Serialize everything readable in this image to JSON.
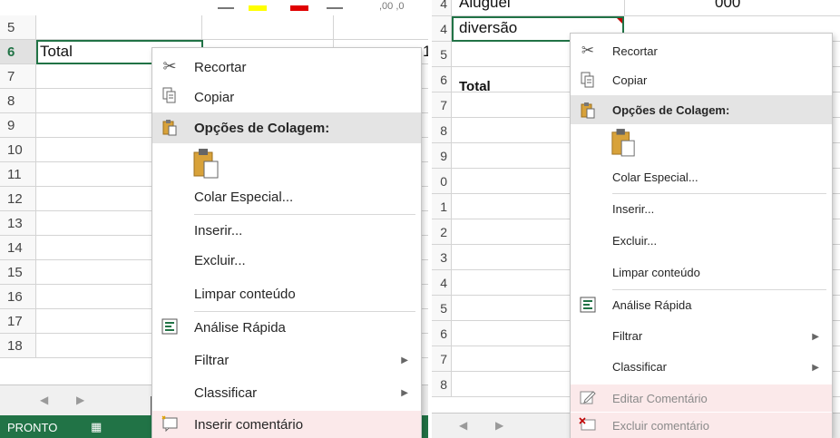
{
  "left": {
    "rows": [
      {
        "num": "5",
        "text": ""
      },
      {
        "num": "6",
        "text": "Total"
      },
      {
        "num": "7",
        "text": ""
      },
      {
        "num": "8",
        "text": ""
      },
      {
        "num": "9",
        "text": ""
      },
      {
        "num": "10",
        "text": ""
      },
      {
        "num": "11",
        "text": ""
      },
      {
        "num": "12",
        "text": ""
      },
      {
        "num": "13",
        "text": ""
      },
      {
        "num": "14",
        "text": ""
      },
      {
        "num": "15",
        "text": ""
      },
      {
        "num": "16",
        "text": ""
      },
      {
        "num": "17",
        "text": ""
      },
      {
        "num": "18",
        "text": ""
      }
    ],
    "active_row": "6",
    "edge_digit": "1",
    "tab_prev": "◀",
    "tab_next": "▶",
    "status": "PRONTO",
    "ribbon_fragment": ",00 ,0",
    "menu": {
      "cut": "Recortar",
      "copy": "Copiar",
      "paste_header": "Opções de Colagem:",
      "paste_special": "Colar Especial...",
      "insert": "Inserir...",
      "delete": "Excluir...",
      "clear": "Limpar conteúdo",
      "quick_analysis": "Análise Rápida",
      "filter": "Filtrar",
      "sort": "Classificar",
      "insert_comment": "Inserir comentário"
    }
  },
  "right": {
    "rows": [
      {
        "num": "4",
        "text": "Aluguel",
        "value": "000"
      },
      {
        "num": "4",
        "text": "diversão",
        "value": ""
      },
      {
        "num": "5",
        "text": "",
        "value": ""
      },
      {
        "num": "6",
        "text": "Total",
        "value": ""
      },
      {
        "num": "7",
        "text": "",
        "value": ""
      },
      {
        "num": "8",
        "text": "",
        "value": ""
      },
      {
        "num": "9",
        "text": "",
        "value": ""
      },
      {
        "num": "0",
        "text": "",
        "value": ""
      },
      {
        "num": "1",
        "text": "",
        "value": ""
      },
      {
        "num": "2",
        "text": "",
        "value": ""
      },
      {
        "num": "3",
        "text": "",
        "value": ""
      },
      {
        "num": "4",
        "text": "",
        "value": ""
      },
      {
        "num": "5",
        "text": "",
        "value": ""
      },
      {
        "num": "6",
        "text": "",
        "value": ""
      },
      {
        "num": "7",
        "text": "",
        "value": ""
      },
      {
        "num": "8",
        "text": "",
        "value": ""
      }
    ],
    "tab_prev": "◀",
    "tab_next": "▶",
    "menu": {
      "cut": "Recortar",
      "copy": "Copiar",
      "paste_header": "Opções de Colagem:",
      "paste_special": "Colar Especial...",
      "insert": "Inserir...",
      "delete": "Excluir...",
      "clear": "Limpar conteúdo",
      "quick_analysis": "Análise Rápida",
      "filter": "Filtrar",
      "sort": "Classificar",
      "edit_comment": "Editar Comentário",
      "delete_comment": "Excluir comentário"
    }
  },
  "colors": {
    "excel_green": "#217346",
    "highlight_yellow": "#ffff00",
    "font_red": "#e00000",
    "menu_pink": "#fbe9ea",
    "header_gray": "#e4e4e4"
  },
  "icons": {
    "cut": "scissors-icon",
    "copy": "copy-icon",
    "paste": "clipboard-icon",
    "quick_analysis": "quick-analysis-icon",
    "new_comment": "new-comment-icon",
    "edit_comment": "edit-comment-icon",
    "delete_comment": "delete-comment-icon",
    "submenu": "chevron-right-icon"
  }
}
